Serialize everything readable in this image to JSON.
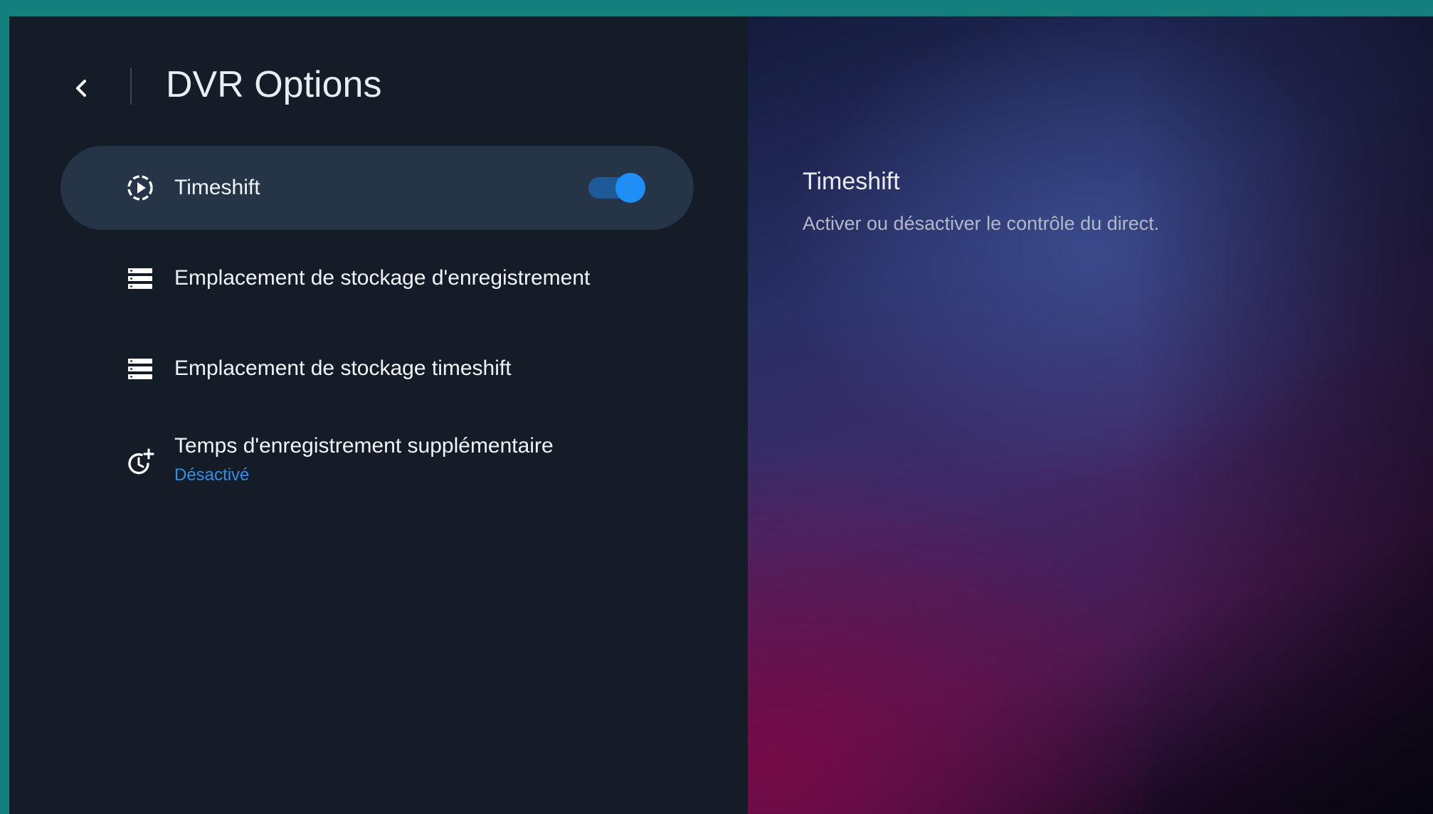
{
  "header": {
    "title": "DVR Options"
  },
  "menu": {
    "items": [
      {
        "label": "Timeshift",
        "icon": "timeshift-icon",
        "toggle_on": true
      },
      {
        "label": "Emplacement de stockage d'enregistrement",
        "icon": "storage-icon"
      },
      {
        "label": "Emplacement de stockage timeshift",
        "icon": "storage-icon"
      },
      {
        "label": "Temps d'enregistrement supplémentaire",
        "sublabel": "Désactivé",
        "icon": "clock-plus-icon"
      }
    ]
  },
  "details": {
    "title": "Timeshift",
    "description": "Activer ou désactiver le contrôle du direct."
  },
  "colors": {
    "accent": "#1f8ff5",
    "selected_bg": "#253447",
    "panel_bg": "#141d27",
    "sublabel": "#2f8fe8"
  }
}
